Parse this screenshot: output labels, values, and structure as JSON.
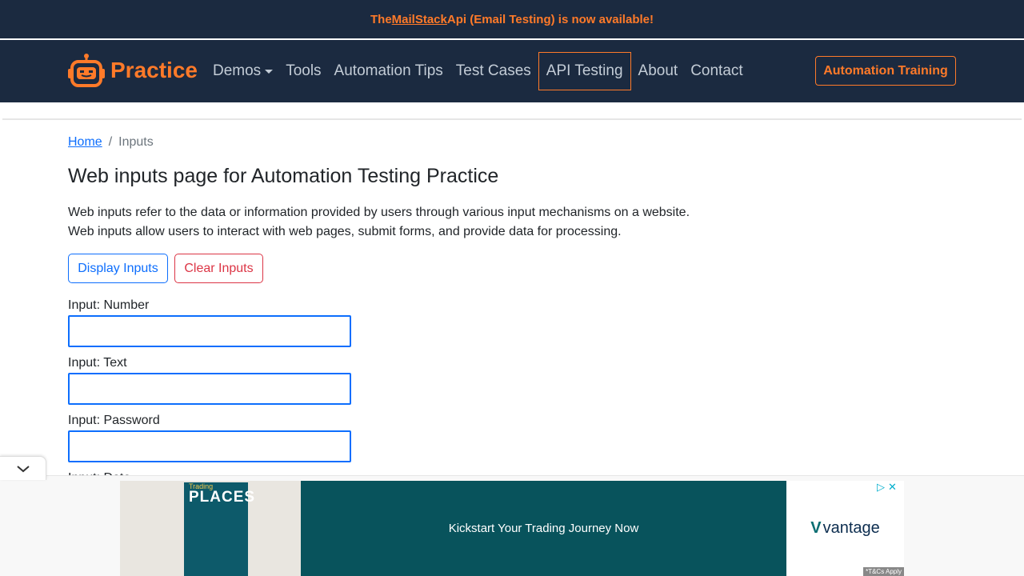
{
  "announcement": {
    "prefix": "The ",
    "link": "MailStack",
    "suffix": " Api (Email Testing) is now available!"
  },
  "brand": {
    "name": "Practice",
    "logo_icon": "robot-icon"
  },
  "nav": {
    "items": [
      {
        "label": "Demos",
        "dropdown": true
      },
      {
        "label": "Tools"
      },
      {
        "label": "Automation Tips"
      },
      {
        "label": "Test Cases"
      },
      {
        "label": "API Testing",
        "active": true
      },
      {
        "label": "About"
      },
      {
        "label": "Contact"
      }
    ],
    "cta": "Automation Training"
  },
  "breadcrumb": {
    "home": "Home",
    "divider": "/",
    "current": "Inputs"
  },
  "page": {
    "title": "Web inputs page for Automation Testing Practice",
    "desc_line1": "Web inputs refer to the data or information provided by users through various input mechanisms on a website.",
    "desc_line2": "Web inputs allow users to interact with web pages, submit forms, and provide data for processing."
  },
  "actions": {
    "display": "Display Inputs",
    "clear": "Clear Inputs"
  },
  "fields": [
    {
      "label": "Input: Number",
      "value": ""
    },
    {
      "label": "Input: Text",
      "value": ""
    },
    {
      "label": "Input: Password",
      "value": ""
    },
    {
      "label": "Input: Date"
    }
  ],
  "ad": {
    "book_small": "Trading",
    "book_title": "PLACES",
    "headline": "Kickstart Your Trading Journey Now",
    "brand": "vantage",
    "terms": "*T&Cs Apply"
  },
  "colors": {
    "nav_bg": "#1b2a40",
    "accent": "#ff7a29",
    "primary": "#0d6efd",
    "danger": "#dc3545",
    "ad_bg": "#08535c"
  }
}
